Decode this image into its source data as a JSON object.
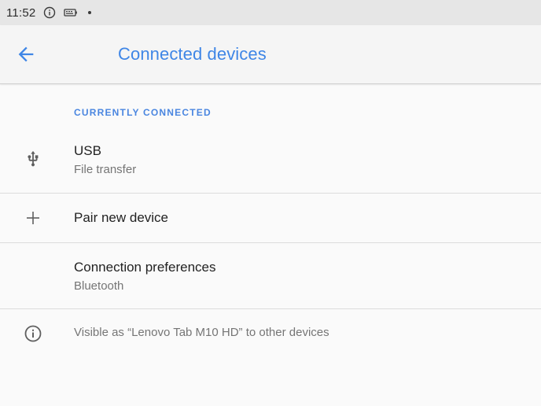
{
  "status_bar": {
    "time": "11:52",
    "icons": [
      "info-icon",
      "battery-saver-icon",
      "notification-dot"
    ]
  },
  "app_bar": {
    "back_icon": "arrow-back-icon",
    "title": "Connected devices"
  },
  "section": {
    "header": "CURRENTLY CONNECTED"
  },
  "items": [
    {
      "icon": "usb-icon",
      "title": "USB",
      "subtitle": "File transfer"
    },
    {
      "icon": "plus-icon",
      "title": "Pair new device"
    },
    {
      "title": "Connection preferences",
      "subtitle": "Bluetooth"
    }
  ],
  "footer": {
    "icon": "info-icon",
    "text": "Visible as “Lenovo Tab M10 HD” to other devices"
  },
  "colors": {
    "accent": "#3f86e6",
    "background": "#fafafa",
    "status_bar": "#e6e6e6",
    "primary_text": "#222222",
    "secondary_text": "#757575",
    "divider": "#dcdcdc"
  }
}
